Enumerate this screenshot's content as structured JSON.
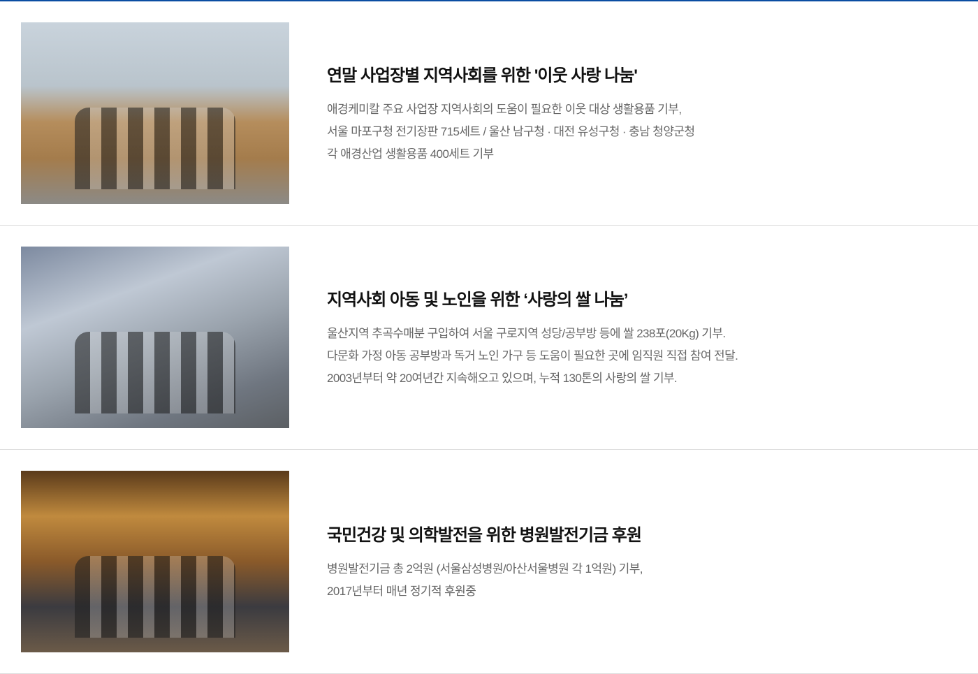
{
  "items": [
    {
      "title": "연말 사업장별 지역사회를 위한 '이웃 사랑 나눔'",
      "lines": [
        "애경케미칼 주요 사업장 지역사회의 도움이 필요한 이웃 대상 생활용품 기부,",
        "서울 마포구청 전기장판 715세트 / 울산 남구청 · 대전 유성구청 · 충남 청양군청",
        "각 애경산업 생활용품 400세트 기부"
      ]
    },
    {
      "title": "지역사회 아동 및 노인을 위한 ‘사랑의 쌀 나눔’",
      "lines": [
        "울산지역 추곡수매분 구입하여 서울 구로지역 성당/공부방 등에 쌀 238포(20Kg) 기부.",
        "다문화 가정 아동 공부방과 독거 노인 가구 등 도움이 필요한 곳에 임직원 직접 참여 전달.",
        "2003년부터 약 20여년간 지속해오고 있으며, 누적 130톤의 사랑의 쌀 기부."
      ]
    },
    {
      "title": "국민건강 및 의학발전을 위한 병원발전기금 후원",
      "lines": [
        "병원발전기금 총 2억원 (서울삼성병원/아산서울병원 각 1억원) 기부,",
        "2017년부터 매년 정기적 후원중"
      ]
    }
  ]
}
